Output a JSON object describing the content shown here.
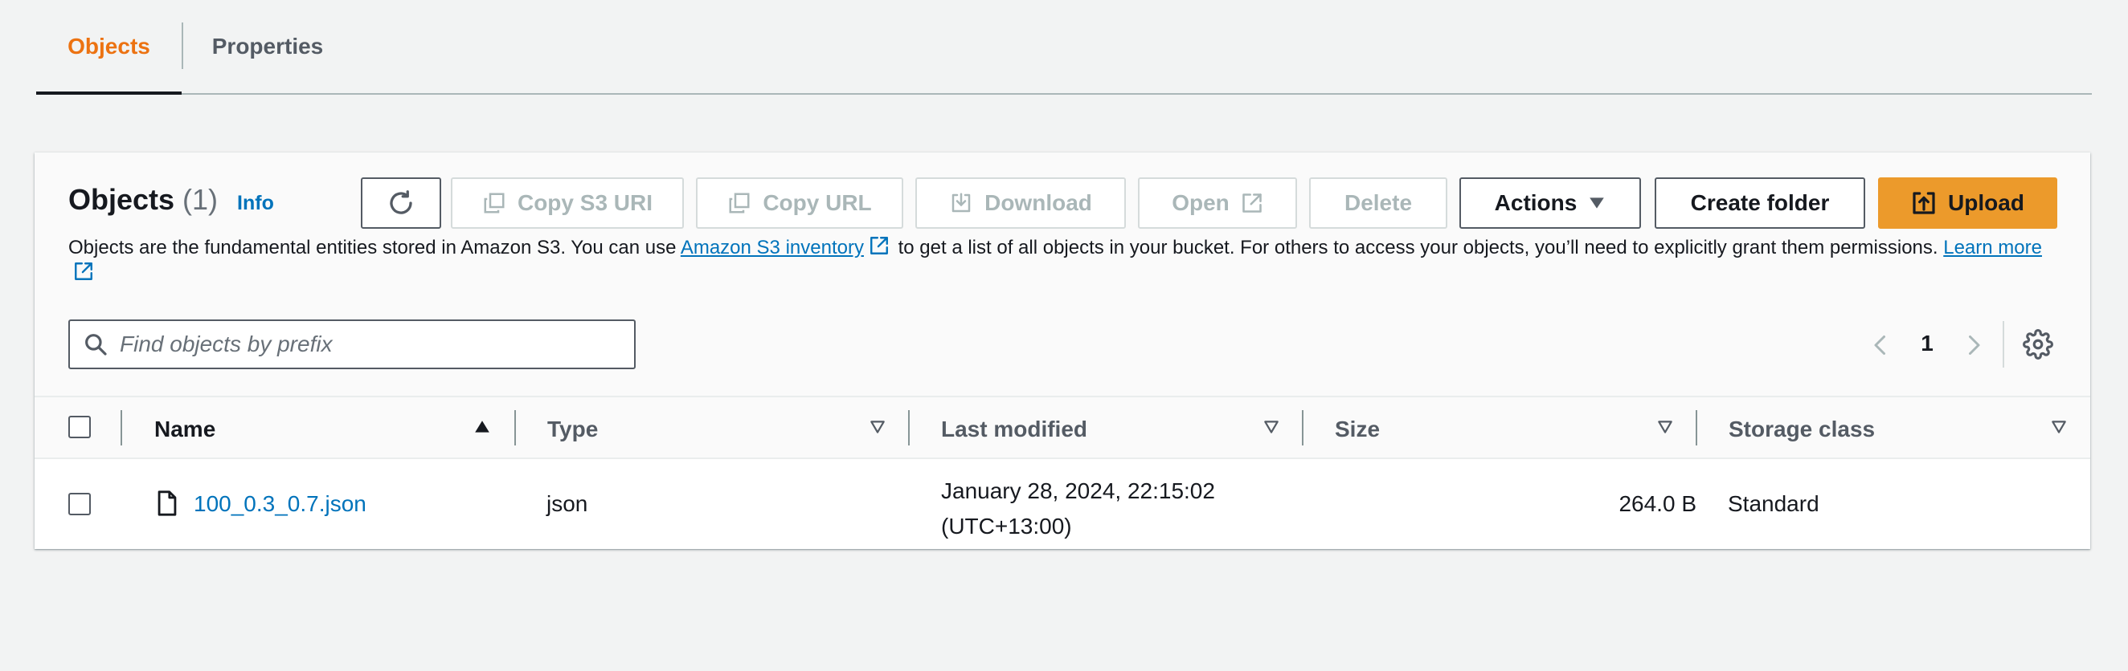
{
  "tabs": [
    {
      "label": "Objects",
      "active": true
    },
    {
      "label": "Properties",
      "active": false
    }
  ],
  "header": {
    "title": "Objects",
    "count": "(1)",
    "info": "Info"
  },
  "toolbar": {
    "refresh_icon": "refresh-icon",
    "copy_s3_uri": "Copy S3 URI",
    "copy_url": "Copy URL",
    "download": "Download",
    "open": "Open",
    "delete": "Delete",
    "actions": "Actions",
    "create_folder": "Create folder",
    "upload": "Upload"
  },
  "description": {
    "text_before": "Objects are the fundamental entities stored in Amazon S3. You can use ",
    "inventory_link": "Amazon S3 inventory",
    "text_after": " to get a list of all objects in your bucket. For others to access your objects, you’ll need to explicitly grant them permissions. ",
    "learn_more": "Learn more"
  },
  "search": {
    "placeholder": "Find objects by prefix",
    "value": ""
  },
  "pagination": {
    "current_page": "1"
  },
  "table": {
    "columns": [
      {
        "label": "Name",
        "sort": "ascending"
      },
      {
        "label": "Type",
        "sort": "none"
      },
      {
        "label": "Last modified",
        "sort": "none"
      },
      {
        "label": "Size",
        "sort": "none"
      },
      {
        "label": "Storage class",
        "sort": "none"
      }
    ],
    "rows": [
      {
        "name": "100_0.3_0.7.json",
        "type": "json",
        "last_modified_line1": "January 28, 2024, 22:15:02",
        "last_modified_line2": "(UTC+13:00)",
        "size": "264.0 B",
        "storage_class": "Standard"
      }
    ]
  },
  "colors": {
    "accent_orange": "#ec7211",
    "upload_button": "#ec9a2b",
    "link_blue": "#0073bb",
    "text_dark": "#16191f",
    "text_gray": "#545b64",
    "disabled_gray": "#aab7b8"
  }
}
